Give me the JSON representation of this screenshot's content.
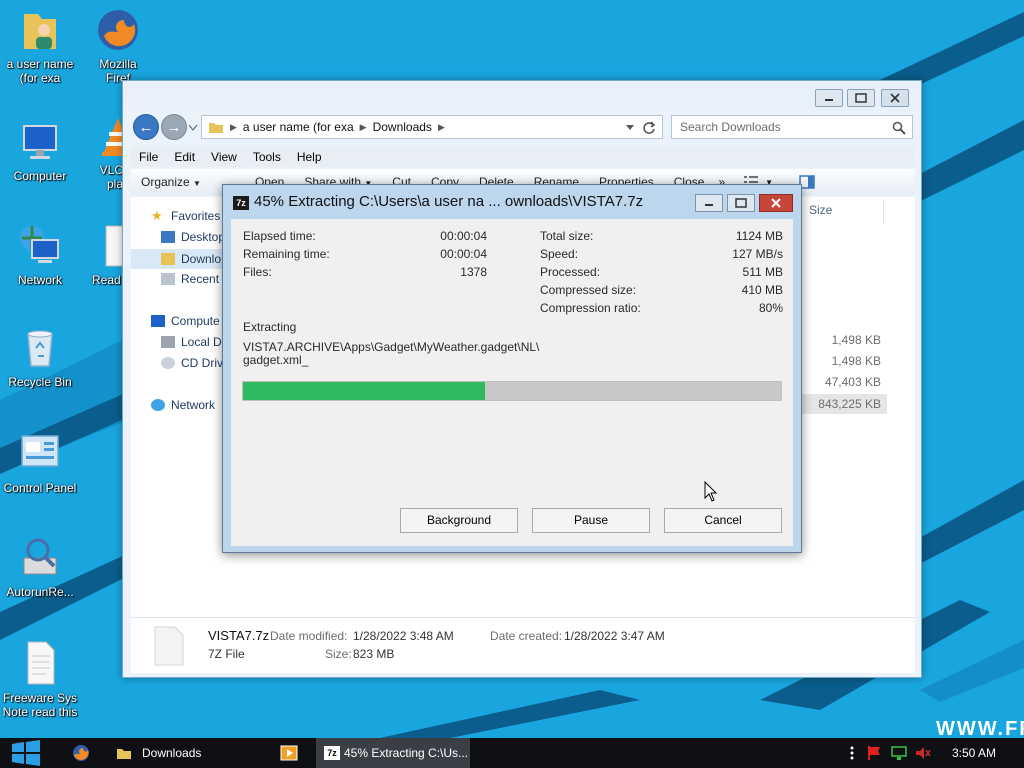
{
  "desktop": {
    "icons": [
      {
        "label": "a user name (for exa",
        "icon": "user-folder-icon"
      },
      {
        "label": "Mozilla Firef",
        "icon": "firefox-icon"
      },
      {
        "label": "Computer",
        "icon": "computer-icon"
      },
      {
        "label": "VLC m play",
        "icon": "vlc-icon"
      },
      {
        "label": "Network",
        "icon": "network-icon"
      },
      {
        "label": "Read",
        "icon": "document-icon"
      },
      {
        "label": "Recycle Bin",
        "icon": "recycle-bin-icon"
      },
      {
        "label": "Control Panel",
        "icon": "control-panel-icon"
      },
      {
        "label": "AutorunRe...",
        "icon": "autorun-icon"
      },
      {
        "label": "Freeware Sys Note read this",
        "icon": "text-file-icon"
      }
    ],
    "watermark": "WWW.FR"
  },
  "explorer": {
    "address": {
      "crumbs": [
        "a user name (for exa",
        "Downloads"
      ]
    },
    "search_placeholder": "Search Downloads",
    "menu": [
      "File",
      "Edit",
      "View",
      "Tools",
      "Help"
    ],
    "toolbar": [
      "Organize",
      "Open",
      "Share with",
      "Cut",
      "Copy",
      "Delete",
      "Rename",
      "Properties",
      "Close"
    ],
    "nav": {
      "favorites": "Favorites",
      "desktop": "Desktop",
      "downloads": "Downlo",
      "recent": "Recent",
      "computer": "Compute",
      "local_disk": "Local Di",
      "cd_drive": "CD Driv",
      "network": "Network"
    },
    "column_size": "Size",
    "sizes": [
      "1,498 KB",
      "1,498 KB",
      "47,403 KB",
      "843,225 KB"
    ],
    "details": {
      "name": "VISTA7.7z",
      "type": "7Z File",
      "date_modified_label": "Date modified:",
      "date_modified": "1/28/2022 3:48 AM",
      "size_label": "Size:",
      "size": "823 MB",
      "date_created_label": "Date created:",
      "date_created": "1/28/2022 3:47 AM"
    }
  },
  "zip_dialog": {
    "icon_label": "7z",
    "title": "45% Extracting C:\\Users\\a user na ... ownloads\\VISTA7.7z",
    "stats_left": [
      {
        "label": "Elapsed time:",
        "value": "00:00:04"
      },
      {
        "label": "Remaining time:",
        "value": "00:00:04"
      },
      {
        "label": "Files:",
        "value": "1378"
      }
    ],
    "stats_right": [
      {
        "label": "Total size:",
        "value": "1124 MB"
      },
      {
        "label": "Speed:",
        "value": "127 MB/s"
      },
      {
        "label": "Processed:",
        "value": "511 MB"
      },
      {
        "label": "Compressed size:",
        "value": "410 MB"
      },
      {
        "label": "Compression ratio:",
        "value": "80%"
      }
    ],
    "status_label": "Extracting",
    "current_file": "VISTA7.ARCHIVE\\Apps\\Gadget\\MyWeather.gadget\\NL\\",
    "current_file_2": "gadget.xml_",
    "progress_fraction": 0.45,
    "buttons": {
      "background": "Background",
      "pause": "Pause",
      "cancel": "Cancel"
    }
  },
  "taskbar": {
    "tasks": {
      "explorer": "Downloads",
      "zip": "45% Extracting C:\\Us..."
    },
    "clock": "3:50 AM"
  },
  "colors": {
    "desktop": "#1aa7e0",
    "progress": "#2fba5f",
    "taskbar": "#0e1013"
  }
}
